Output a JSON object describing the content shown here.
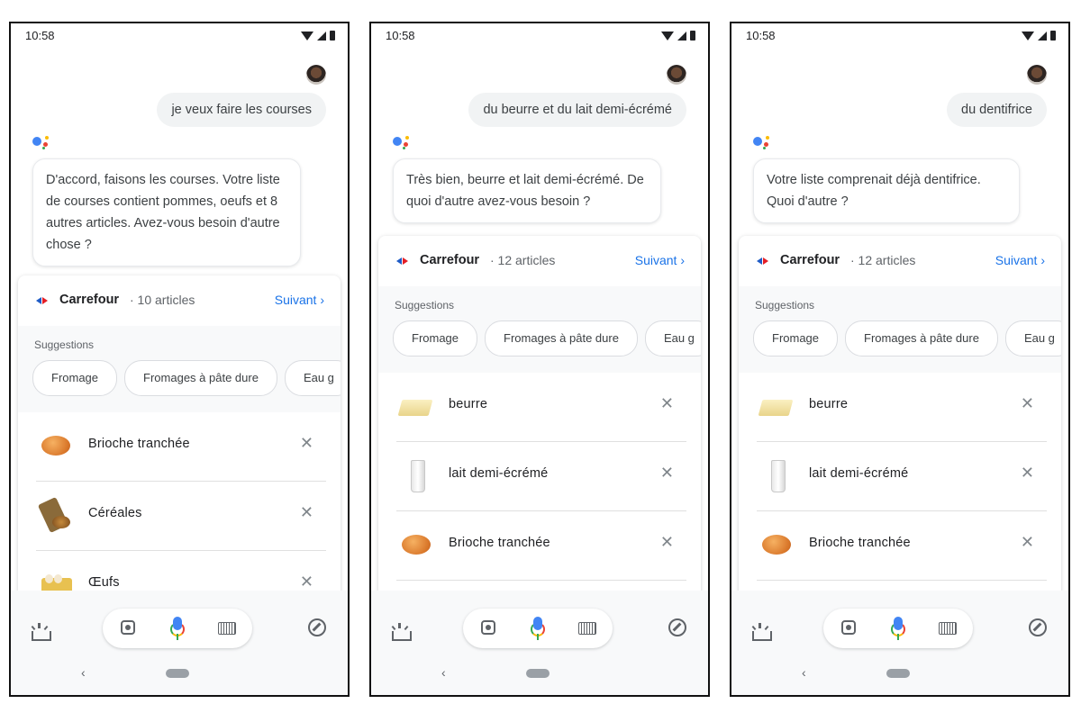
{
  "status_time": "10:58",
  "colors": {
    "accent": "#1a73e8",
    "chip_bg": "#ffffff",
    "screen_bg": "#ffffff"
  },
  "screens": [
    {
      "user_message": "je veux faire les courses",
      "assistant_message": "D'accord, faisons les courses. Votre liste de courses contient pommes, oeufs et 8 autres articles. Avez-vous besoin d'autre chose ?",
      "store": "Carrefour",
      "count": "· 10 articles",
      "next": "Suivant",
      "suggestions_title": "Suggestions",
      "chips": [
        "Fromage",
        "Fromages à pâte dure",
        "Eau g"
      ],
      "items": [
        {
          "label": "Brioche tranchée",
          "icon": "brioche-image"
        },
        {
          "label": "Céréales",
          "icon": "cereal-image"
        },
        {
          "label": "Œufs",
          "icon": "eggs-image"
        }
      ]
    },
    {
      "user_message": "du beurre et du lait demi-écrémé",
      "assistant_message": "Très bien, beurre et lait demi-écrémé. De quoi d'autre avez-vous besoin ?",
      "store": "Carrefour",
      "count": "· 12 articles",
      "next": "Suivant",
      "suggestions_title": "Suggestions",
      "chips": [
        "Fromage",
        "Fromages à pâte dure",
        "Eau g"
      ],
      "items": [
        {
          "label": "beurre",
          "icon": "butter-image"
        },
        {
          "label": "lait demi-écrémé",
          "icon": "milk-image"
        },
        {
          "label": "Brioche tranchée",
          "icon": "brioche-image"
        }
      ]
    },
    {
      "user_message": "du dentifrice",
      "assistant_message": "Votre liste comprenait déjà dentifrice. Quoi d'autre ?",
      "store": "Carrefour",
      "count": "· 12 articles",
      "next": "Suivant",
      "suggestions_title": "Suggestions",
      "chips": [
        "Fromage",
        "Fromages à pâte dure",
        "Eau g"
      ],
      "items": [
        {
          "label": "beurre",
          "icon": "butter-image"
        },
        {
          "label": "lait demi-écrémé",
          "icon": "milk-image"
        },
        {
          "label": "Brioche tranchée",
          "icon": "brioche-image"
        }
      ]
    }
  ]
}
